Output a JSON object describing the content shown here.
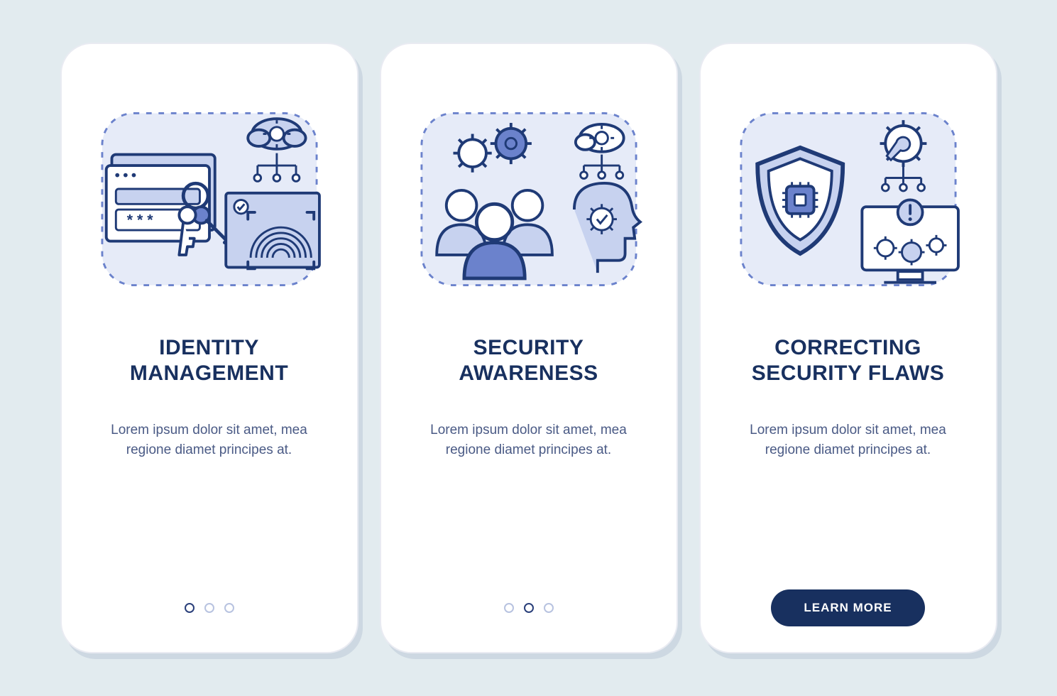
{
  "screens": [
    {
      "title_line1": "Identity",
      "title_line2": "Management",
      "body": "Lorem ipsum dolor sit amet, mea regione diamet principes at.",
      "active_dot": 0,
      "has_cta": false
    },
    {
      "title_line1": "Security",
      "title_line2": "Awareness",
      "body": "Lorem ipsum dolor sit amet, mea regione diamet principes at.",
      "active_dot": 1,
      "has_cta": false
    },
    {
      "title_line1": "Correcting",
      "title_line2": "Security Flaws",
      "body": "Lorem ipsum dolor sit amet, mea regione diamet principes at.",
      "active_dot": 2,
      "has_cta": true
    }
  ],
  "cta_label": "LEARN MORE",
  "colors": {
    "background": "#e2ebef",
    "primary_ink": "#1f3a76",
    "accent": "#6b82cc",
    "accent_light": "#c7d2ef"
  }
}
